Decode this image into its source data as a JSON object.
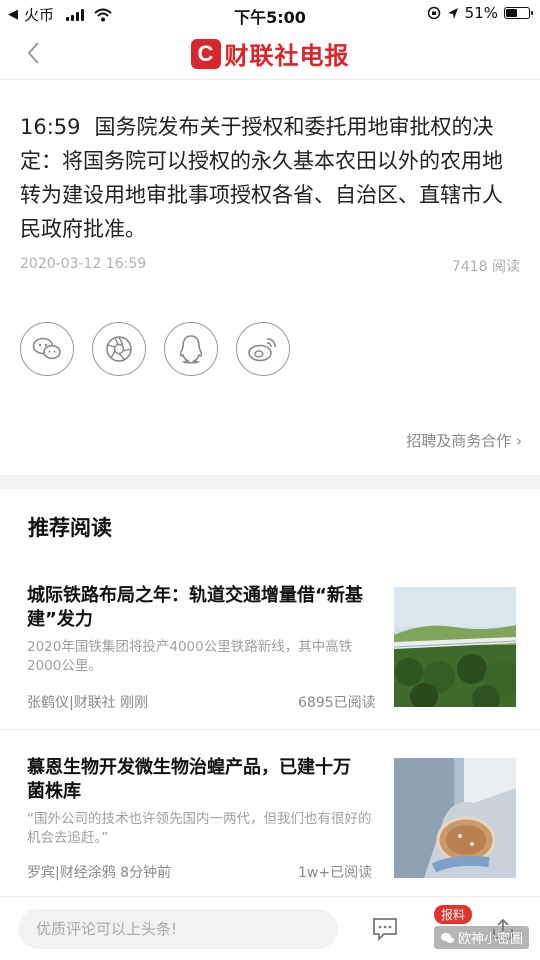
{
  "status_bar": {
    "back_app": "◀",
    "carrier": "火币",
    "time": "下午5:00",
    "battery": "51%",
    "battery_level": 0.51
  },
  "nav": {
    "logo_mark": "C",
    "logo_text": "财联社电报"
  },
  "article": {
    "time": "16:59",
    "text": "国务院发布关于授权和委托用地审批权的决定：将国务院可以授权的永久基本农田以外的农用地转为建设用地审批事项授权各省、自治区、直辖市人民政府批准。",
    "date": "2020-03-12 16:59",
    "reads": "7418 阅读"
  },
  "share": {
    "icons": [
      "wechat-icon",
      "moments-icon",
      "qq-icon",
      "weibo-icon"
    ]
  },
  "recruit_link": "招聘及商务合作 ›",
  "recommend": {
    "title": "推荐阅读",
    "items": [
      {
        "title": "城际铁路布局之年：轨道交通增量借“新基建”发力",
        "desc": "2020年国铁集团将投产4000公里铁路新线，其中高铁2000公里。",
        "source": "张鹤仪|财联社  刚刚",
        "reads": "6895已阅读"
      },
      {
        "title": "慕恩生物开发微生物治蝗产品，已建十万菌株库",
        "desc": "“国外公司的技术也许领先国内一两代，但我们也有很好的机会去追赶。”",
        "source": "罗宾|财经涂鸦  8分钟前",
        "reads": "1w+已阅读"
      }
    ]
  },
  "bottom_bar": {
    "comment_placeholder": "优质评论可以上头条!",
    "baoliao": "报料",
    "watermark": "欧神小密圈"
  },
  "colors": {
    "brand_red": "#d8262c",
    "meta_gray": "#b0b0b0"
  }
}
